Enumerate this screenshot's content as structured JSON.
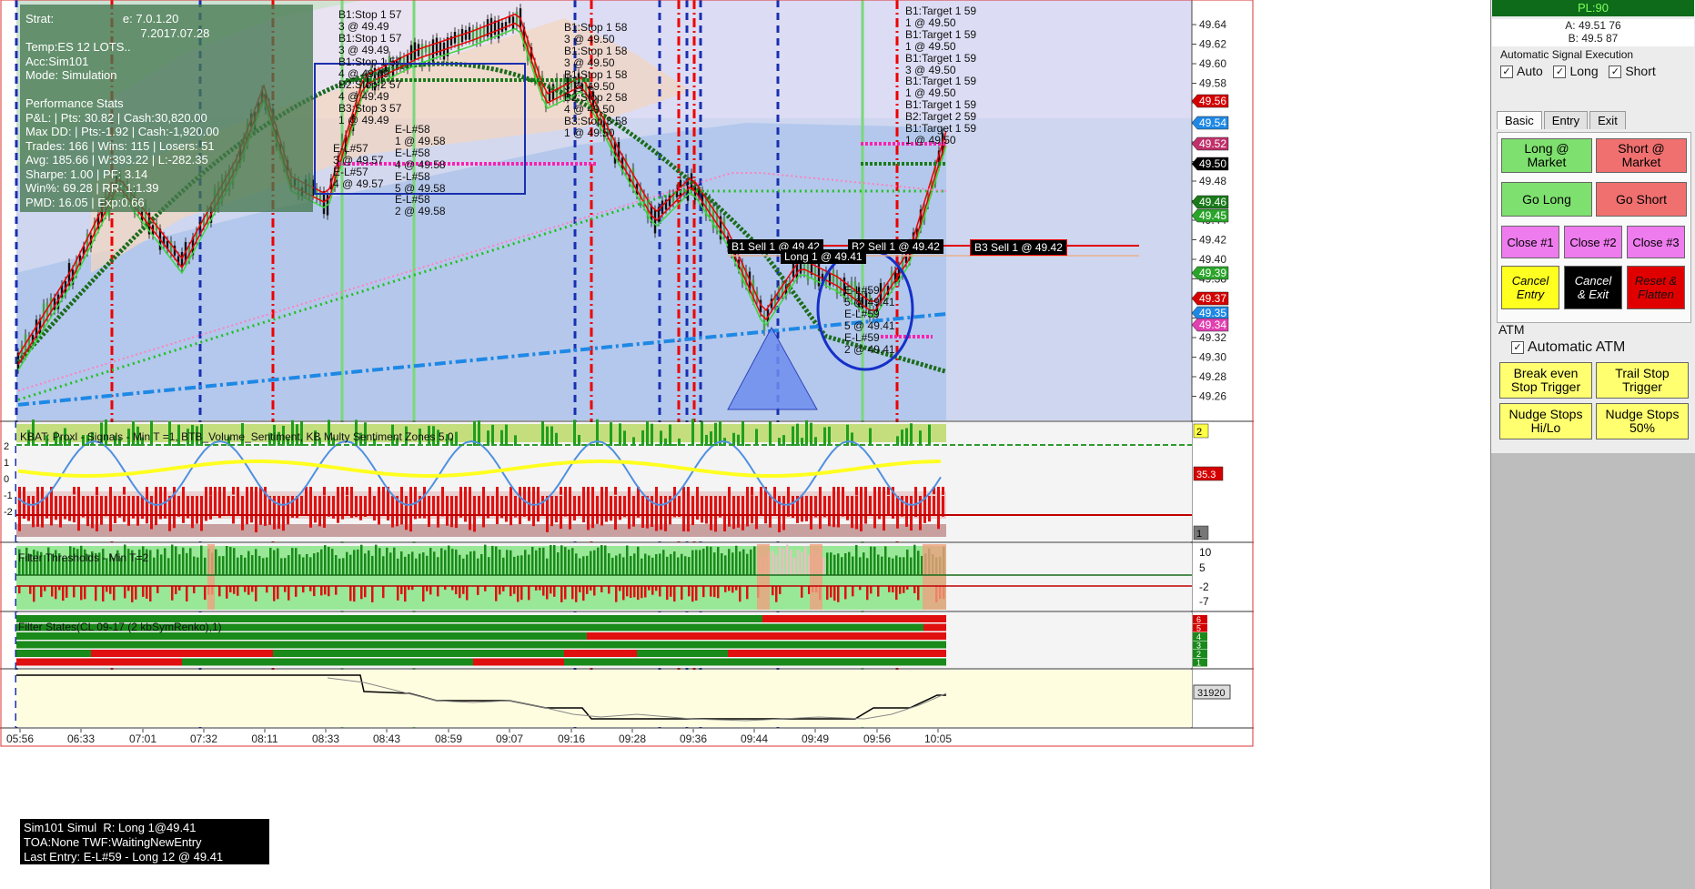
{
  "info_box": {
    "lines": [
      "Strat:                     e: 7.0.1.20",
      "                                   7.2017.07.28",
      "Temp:ES 12 LOTS..",
      "Acc:Sim101",
      "Mode: Simulation",
      "",
      "Performance Stats",
      "P&L: | Pts: 30.82 | Cash:30,820.00",
      "Max DD: | Pts:-1.92 | Cash:-1,920.00",
      "Trades: 166 | Wins: 115 | Losers: 51",
      "Avg: 185.66 | W:393.22 | L:-282.35",
      "Sharpe: 1.00 | PF: 3.14",
      "Win%: 69.28 | RR: 1:1.39",
      "PMD: 16.05 | Exp:0.66"
    ]
  },
  "status_box": {
    "lines": [
      "Sim101 Simul  R: Long 1@49.41",
      "TOA:None TWF:WaitingNewEntry",
      "Last Entry: E-L#59 - Long 12 @ 49.41"
    ]
  },
  "price_axis": {
    "labels": [
      "49.64",
      "49.62",
      "49.60",
      "49.58",
      "49.56",
      "49.54",
      "49.52",
      "49.50",
      "49.48",
      "49.46",
      "49.44",
      "49.42",
      "49.40",
      "49.38",
      "49.36",
      "49.34",
      "49.32",
      "49.30",
      "49.28",
      "49.26"
    ],
    "tags": [
      {
        "text": "49.56",
        "color": "#d40000"
      },
      {
        "text": "49.54",
        "color": "#1e88e5"
      },
      {
        "text": "49.52",
        "color": "#c0306a"
      },
      {
        "text": "49.50",
        "color": "#000000"
      },
      {
        "text": "49.46",
        "color": "#1a7a1a"
      },
      {
        "text": "49.45",
        "color": "#2aa52a"
      },
      {
        "text": "49.39",
        "color": "#2aa52a"
      },
      {
        "text": "49.37",
        "color": "#d40000"
      },
      {
        "text": "49.35",
        "color": "#1e88e5"
      },
      {
        "text": "49.34",
        "color": "#e040b0"
      }
    ]
  },
  "time_axis": [
    "05:56",
    "06:33",
    "07:01",
    "07:32",
    "08:11",
    "08:33",
    "08:43",
    "08:59",
    "09:07",
    "09:16",
    "09:28",
    "09:36",
    "09:44",
    "09:49",
    "09:56",
    "10:05"
  ],
  "trade_labels": {
    "left_stops": [
      "B1:Stop 1 57",
      "3 @ 49.49",
      "B1:Stop 1 57",
      "3 @ 49.49",
      "B1:Stop 1 57",
      "4 @ 49.49",
      "B2:Stop 2 57",
      "4 @ 49.49",
      "B3:Stop 3 57",
      "1 @ 49.49"
    ],
    "left_entries": [
      "E-L#58",
      "1 @ 49.58",
      "E-L#58",
      "4 @ 49.58",
      "E-L#58",
      "5 @ 49.58",
      "E-L#58",
      "2 @ 49.58"
    ],
    "left_small": [
      "E-L#57",
      "3 @ 49.57",
      "E-L#57",
      "4 @ 49.57"
    ],
    "mid_stops": [
      "B1:Stop 1 58",
      "3 @ 49.50",
      "B1:Stop 1 58",
      "3 @ 49.50",
      "B1:Stop 1 58",
      "3 @ 49.50",
      "B2:Stop 2 58",
      "4 @ 49.50",
      "B3:Stop 3 58",
      "1 @ 49.50"
    ],
    "right_targets": [
      "B1:Target 1 59",
      "1 @ 49.50",
      "B1:Target 1 59",
      "1 @ 49.50",
      "B1:Target 1 59",
      "3 @ 49.50",
      "B1:Target 1 59",
      "1 @ 49.50",
      "B1:Target 1 59",
      "B2:Target 2 59",
      "B1:Target 1 59",
      "1 @ 49.50"
    ],
    "right_entries": [
      "E-L#59",
      "5 @ 49.41",
      "E-L#59",
      "5 @ 49.41",
      "E-L#59",
      "2 @ 49.41"
    ],
    "sell_tags": [
      "B1 Sell 1  @ 49.42",
      "B2 Sell 1  @ 49.42",
      "B3 Sell 1  @ 49.42"
    ],
    "long_tag": "Long 1 @ 49.41"
  },
  "panels": {
    "kbat": {
      "title": "KBAT: Proxl - Signals - Min T =1, BTB_Volume_Sentiment,                             KB Multy Sentiment Zones 5.0",
      "left_ticks": [
        "2",
        "1",
        "0",
        "-1",
        "-2"
      ],
      "right_tags": [
        {
          "text": "2",
          "color": "#ffff44",
          "fg": "#000"
        },
        {
          "text": "35.3",
          "color": "#d40000",
          "fg": "#fff"
        },
        {
          "text": "1",
          "color": "#777777",
          "fg": "#000"
        }
      ]
    },
    "filter_thresholds": {
      "title": "Filter Thresholds - Min T=2",
      "right_labels": [
        "10",
        "5",
        "-2",
        "-7"
      ]
    },
    "filter_states": {
      "title": "Filter States(CL 09-17 (2 kbSymRenko),1)",
      "right_labels": [
        "6",
        "5",
        "4",
        "3",
        "2",
        "1"
      ]
    },
    "equity": {
      "right_tag": "31920"
    }
  },
  "side_panel": {
    "pl": "PL:90",
    "ask": "A: 49.51 76",
    "bid": "B: 49.5 87",
    "auto_title": "Automatic Signal Execution",
    "checks": [
      "Auto",
      "Long",
      "Short"
    ],
    "tabs": [
      "Basic",
      "Entry",
      "Exit"
    ],
    "buttons": {
      "long_market": "Long @\nMarket",
      "short_market": "Short @\nMarket",
      "go_long": "Go Long",
      "go_short": "Go Short",
      "close1": "Close #1",
      "close2": "Close #2",
      "close3": "Close #3",
      "cancel_entry": "Cancel\nEntry",
      "cancel_exit": "Cancel\n& Exit",
      "reset_flatten": "Reset &\nFlatten"
    },
    "atm_title": "ATM",
    "atm_check": "Automatic ATM",
    "atm_buttons": {
      "break_even": "Break even\nStop Trigger",
      "trail_stop": "Trail Stop\nTrigger",
      "nudge_hilo": "Nudge Stops\nHi/Lo",
      "nudge_50": "Nudge Stops\n50%"
    }
  }
}
